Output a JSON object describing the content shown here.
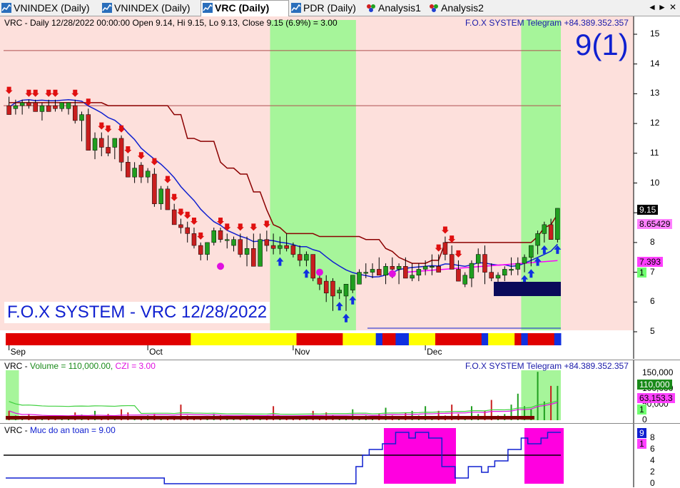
{
  "tabs": [
    {
      "label": "VNINDEX (Daily)",
      "active": false,
      "icon": "chart-icon"
    },
    {
      "label": "VNINDEX (Daily)",
      "active": false,
      "icon": "chart-icon"
    },
    {
      "label": "VRC (Daily)",
      "active": true,
      "icon": "chart-icon"
    },
    {
      "label": "PDR (Daily)",
      "active": false,
      "icon": "chart-icon"
    },
    {
      "label": "Analysis1",
      "active": false,
      "icon": "analysis-icon"
    },
    {
      "label": "Analysis2",
      "active": false,
      "icon": "analysis-icon"
    }
  ],
  "window_controls": {
    "left": "◄",
    "right": "►",
    "close": "✕"
  },
  "main": {
    "header": "VRC - Daily 12/28/2022 00:00:00 Open 9.14, Hi 9.15, Lo 9.13, Close 9.15 (6.9%)  = 3.00",
    "telegram": "F.O.X SYSTEM Telegram +84.389.352.357",
    "big_label": "9(1)",
    "watermark": "F.O.X SYSTEM - VRC 12/28/2022",
    "axis": [
      "15",
      "14",
      "13",
      "12",
      "11",
      "10",
      "9",
      "8",
      "7",
      "6",
      "5"
    ],
    "price_tag": "9.15",
    "ma_tag": "8.65429",
    "trail_tag": "7.393",
    "one_tag": "1",
    "months": [
      "Sep",
      "Oct",
      "Nov",
      "Dec"
    ]
  },
  "volume": {
    "header_prefix": "VRC - ",
    "header_volume": "Volume = 110,000.00,",
    "header_czi": " CZI = 3.00",
    "telegram": "F.O.X SYSTEM Telegram +84.389.352.357",
    "axis": [
      "150,000",
      "100,000",
      "50,000",
      "0"
    ],
    "vol_tag": "110,000",
    "ma_tag": "63,153.3",
    "one_tag": "1"
  },
  "safety": {
    "header_prefix": "VRC - ",
    "header_name": "Muc do an toan = 9.00",
    "axis": [
      "8",
      "6",
      "4",
      "2",
      "0"
    ],
    "value_tag": "9",
    "one_tag": "1"
  },
  "colors": {
    "bull": "#1f9e1f",
    "bear": "#c81e1e",
    "blue_line": "#1020d0",
    "brown_line": "#8b0000",
    "magenta": "#ff00ff",
    "green_zone": "#a6f59a",
    "red_zone": "#fde0dc"
  },
  "chart_data": {
    "type": "candlestick",
    "x": [
      "Sep 01",
      "Sep 05",
      "Sep 06",
      "Sep 07",
      "Sep 08",
      "Sep 09",
      "Sep 12",
      "Sep 13",
      "Sep 14",
      "Sep 15",
      "Sep 16",
      "Sep 19",
      "Sep 20",
      "Sep 21",
      "Sep 22",
      "Sep 23",
      "Sep 26",
      "Sep 27",
      "Sep 28",
      "Sep 29",
      "Sep 30",
      "Oct 03",
      "Oct 04",
      "Oct 05",
      "Oct 06",
      "Oct 07",
      "Oct 10",
      "Oct 11",
      "Oct 12",
      "Oct 13",
      "Oct 14",
      "Oct 17",
      "Oct 18",
      "Oct 19",
      "Oct 20",
      "Oct 21",
      "Oct 24",
      "Oct 25",
      "Oct 26",
      "Oct 27",
      "Oct 28",
      "Oct 31",
      "Nov 01",
      "Nov 02",
      "Nov 03",
      "Nov 04",
      "Nov 07",
      "Nov 08",
      "Nov 09",
      "Nov 10",
      "Nov 11",
      "Nov 14",
      "Nov 15",
      "Nov 16",
      "Nov 17",
      "Nov 18",
      "Nov 21",
      "Nov 22",
      "Nov 23",
      "Nov 24",
      "Nov 25",
      "Nov 28",
      "Nov 29",
      "Nov 30",
      "Dec 01",
      "Dec 02",
      "Dec 05",
      "Dec 06",
      "Dec 07",
      "Dec 08",
      "Dec 09",
      "Dec 12",
      "Dec 13",
      "Dec 14",
      "Dec 15",
      "Dec 16",
      "Dec 19",
      "Dec 20",
      "Dec 21",
      "Dec 22",
      "Dec 23",
      "Dec 26",
      "Dec 27",
      "Dec 28"
    ],
    "open": [
      12.6,
      12.5,
      12.6,
      12.7,
      12.7,
      12.4,
      12.6,
      12.6,
      12.5,
      12.5,
      12.6,
      12.1,
      12.3,
      11.1,
      11.5,
      11.2,
      11.2,
      11.5,
      10.7,
      10.2,
      10.6,
      10.2,
      10.3,
      9.3,
      9.8,
      9.1,
      8.6,
      8.5,
      8.3,
      7.9,
      7.6,
      8.0,
      8.4,
      8.1,
      7.9,
      8.1,
      7.6,
      7.8,
      7.2,
      8.1,
      7.9,
      7.8,
      7.9,
      7.9,
      7.6,
      7.4,
      7.6,
      6.8,
      6.7,
      6.7,
      6.3,
      6.2,
      6.4,
      6.6,
      7.0,
      7.0,
      7.1,
      6.9,
      7.2,
      7.1,
      7.2,
      6.8,
      6.9,
      7.1,
      7.2,
      7.2,
      8.0,
      7.6,
      7.1,
      6.6,
      6.8,
      7.3,
      7.6,
      7.0,
      6.8,
      6.9,
      7.1,
      7.1,
      7.3,
      7.5,
      7.9,
      8.3,
      8.6,
      8.1
    ],
    "high": [
      12.9,
      12.8,
      12.8,
      12.8,
      12.8,
      12.7,
      12.8,
      12.8,
      12.7,
      12.7,
      12.8,
      12.4,
      12.5,
      11.7,
      11.7,
      11.6,
      11.5,
      11.6,
      10.9,
      10.7,
      10.7,
      10.5,
      10.5,
      9.9,
      9.9,
      9.3,
      8.8,
      8.7,
      8.5,
      8.0,
      8.0,
      8.5,
      8.5,
      8.3,
      8.2,
      8.3,
      8.2,
      8.3,
      8.3,
      8.4,
      8.3,
      8.2,
      8.3,
      8.0,
      7.9,
      7.7,
      7.6,
      7.0,
      6.9,
      6.8,
      6.5,
      6.6,
      6.9,
      7.1,
      7.3,
      7.3,
      7.5,
      7.3,
      7.5,
      7.3,
      7.5,
      7.3,
      7.3,
      7.4,
      7.6,
      7.6,
      8.2,
      7.9,
      7.4,
      7.0,
      7.4,
      7.8,
      7.9,
      7.3,
      7.0,
      7.2,
      7.5,
      7.5,
      7.6,
      7.8,
      8.4,
      8.7,
      8.8,
      9.15
    ],
    "low": [
      12.3,
      12.3,
      12.3,
      12.5,
      12.4,
      12.1,
      12.4,
      12.4,
      12.4,
      12.3,
      12.0,
      11.4,
      11.8,
      10.8,
      10.9,
      10.9,
      10.8,
      10.4,
      10.2,
      10.0,
      10.0,
      10.0,
      9.2,
      9.1,
      9.1,
      8.6,
      8.3,
      8.0,
      7.8,
      7.4,
      7.4,
      7.9,
      8.0,
      7.8,
      7.7,
      7.5,
      7.2,
      7.2,
      7.2,
      7.7,
      7.6,
      7.6,
      7.7,
      7.5,
      7.2,
      7.2,
      6.7,
      6.4,
      6.0,
      5.7,
      6.1,
      5.7,
      6.3,
      6.6,
      6.8,
      6.8,
      6.9,
      6.6,
      6.8,
      6.6,
      6.8,
      6.7,
      6.7,
      6.9,
      6.9,
      7.0,
      7.4,
      7.1,
      6.7,
      6.5,
      6.5,
      7.0,
      6.6,
      6.7,
      6.3,
      6.7,
      6.9,
      6.9,
      7.0,
      7.2,
      7.6,
      8.0,
      8.1,
      8.0
    ],
    "close": [
      12.3,
      12.6,
      12.7,
      12.6,
      12.4,
      12.6,
      12.4,
      12.5,
      12.7,
      12.7,
      12.1,
      12.3,
      11.1,
      11.5,
      11.2,
      11.0,
      11.5,
      10.7,
      10.2,
      10.5,
      10.2,
      10.4,
      9.3,
      9.8,
      9.1,
      8.6,
      8.5,
      8.3,
      7.9,
      7.6,
      8.0,
      8.4,
      8.1,
      8.1,
      8.1,
      7.6,
      7.8,
      7.2,
      8.1,
      7.9,
      7.8,
      7.9,
      7.8,
      7.6,
      7.4,
      7.6,
      6.8,
      6.6,
      6.3,
      6.2,
      6.4,
      6.6,
      6.9,
      7.0,
      7.0,
      7.1,
      6.9,
      7.2,
      7.1,
      7.2,
      6.8,
      6.9,
      7.1,
      7.2,
      7.2,
      7.0,
      7.6,
      7.1,
      6.7,
      6.9,
      7.3,
      7.6,
      7.0,
      6.8,
      6.9,
      7.1,
      7.1,
      7.3,
      7.5,
      7.9,
      8.3,
      8.6,
      8.1,
      9.15
    ],
    "volume": [
      30000,
      15000,
      10000,
      20000,
      12000,
      8000,
      10000,
      15000,
      12000,
      10000,
      25000,
      18000,
      10000,
      30000,
      12000,
      20000,
      8000,
      35000,
      25000,
      10000,
      12000,
      15000,
      20000,
      12000,
      10000,
      12000,
      50000,
      15000,
      10000,
      12000,
      8000,
      20000,
      15000,
      10000,
      12000,
      12000,
      10000,
      15000,
      10000,
      12000,
      45000,
      10000,
      12000,
      10000,
      15000,
      12000,
      30000,
      8000,
      25000,
      15000,
      12000,
      10000,
      35000,
      12000,
      15000,
      10000,
      20000,
      40000,
      15000,
      12000,
      25000,
      30000,
      15000,
      45000,
      10000,
      30000,
      15000,
      50000,
      20000,
      12000,
      45000,
      20000,
      30000,
      65000,
      15000,
      20000,
      50000,
      85000,
      45000,
      35000,
      155000,
      60000,
      110000,
      110000
    ],
    "safety": [
      1,
      1,
      1,
      1,
      1,
      1,
      1,
      1,
      1,
      1,
      1,
      1,
      1,
      1,
      1,
      1,
      1,
      1,
      1,
      1,
      1,
      1,
      1,
      1,
      0,
      0,
      0,
      0,
      0,
      0,
      0,
      0,
      0,
      0,
      0,
      0,
      0,
      0,
      0,
      0,
      0,
      0,
      0,
      0,
      0,
      0,
      0,
      0,
      0,
      0,
      0,
      0,
      0,
      3,
      5,
      6,
      6,
      7,
      7,
      9,
      9,
      8,
      9,
      9,
      8,
      8,
      3,
      3,
      1,
      1,
      3,
      3,
      2,
      3,
      4,
      4,
      6,
      6,
      8,
      7,
      7,
      8,
      9,
      9
    ],
    "price_axis_range": [
      4.5,
      15.5
    ]
  }
}
